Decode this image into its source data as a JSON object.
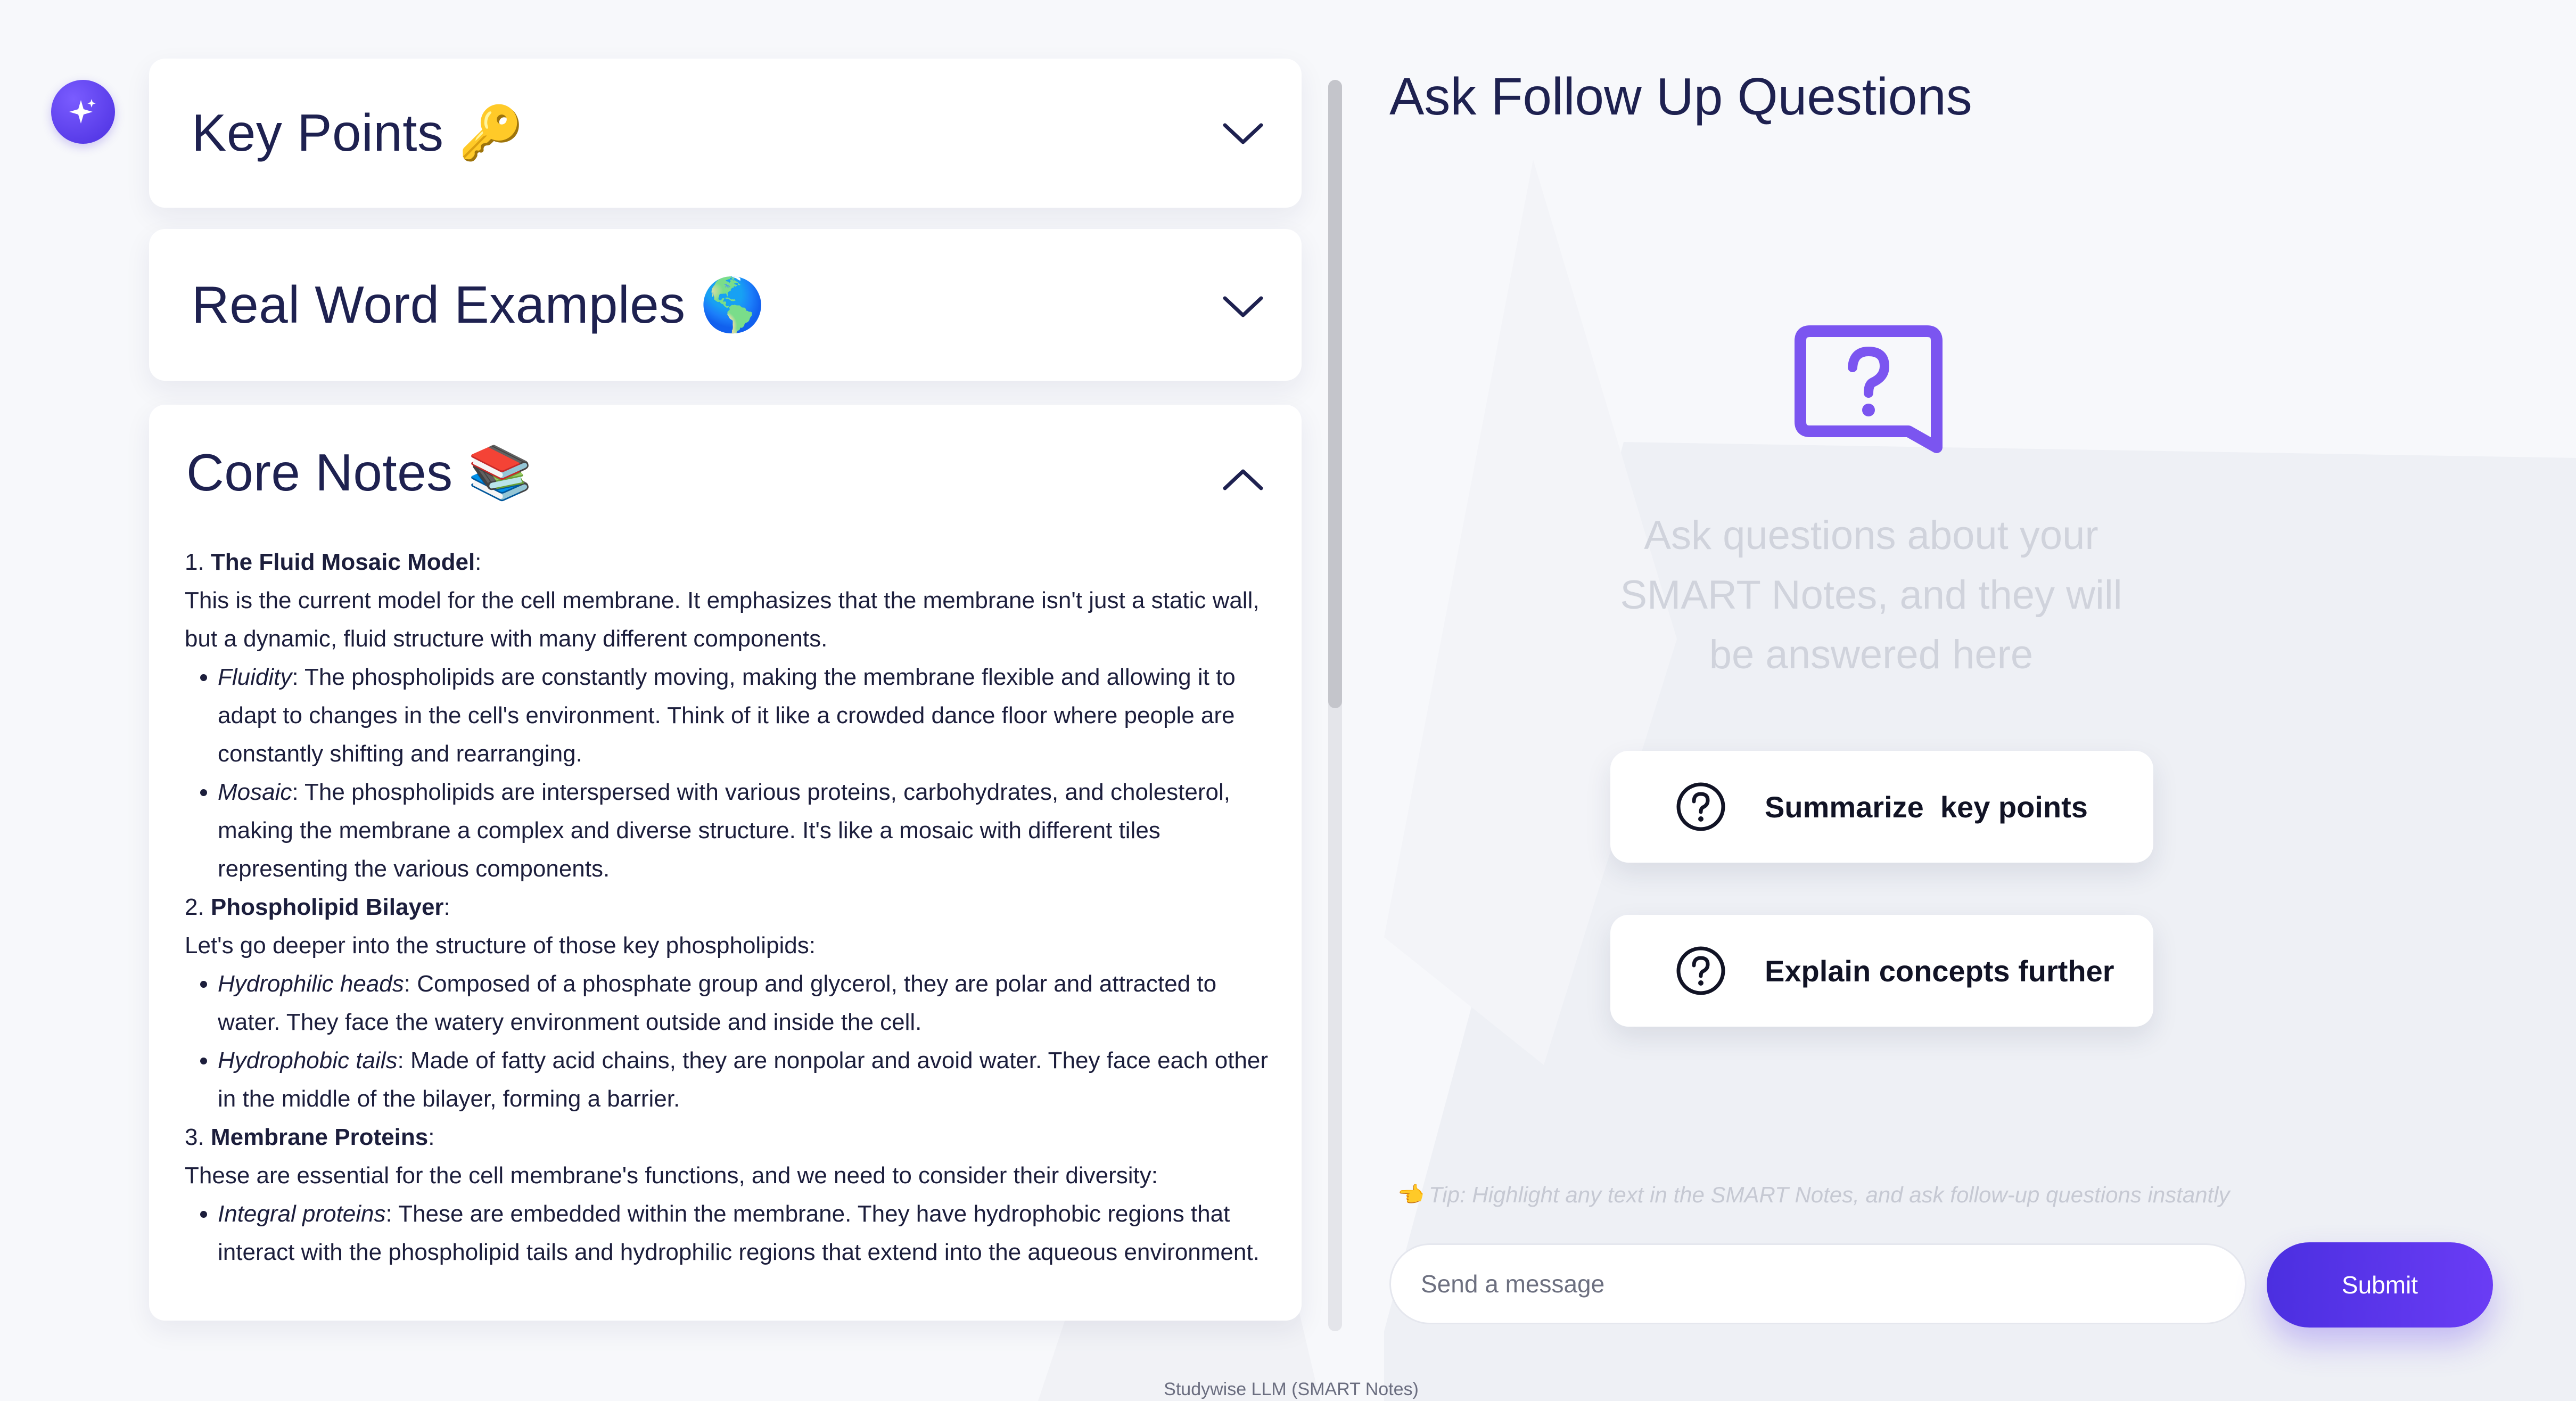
{
  "colors": {
    "accent": "#5b3cf0",
    "title_text": "#1e2150",
    "hint_text": "#d0d3dc"
  },
  "logo": {
    "icon": "sparkle-icon"
  },
  "cards": {
    "key_points": {
      "title": "Key Points 🔑",
      "chevron": "chevron-down-icon"
    },
    "real_world": {
      "title": "Real Word Examples 🌎",
      "chevron": "chevron-down-icon"
    },
    "core_notes": {
      "title": "Core Notes 📚",
      "chevron": "chevron-up-icon"
    }
  },
  "notes": {
    "s1": {
      "num": "1. ",
      "heading": "The Fluid Mosaic Model",
      "intro": "This is the current model for the cell membrane. It emphasizes that the membrane isn't just a static wall, but a dynamic, fluid structure with many different components.",
      "items": [
        {
          "term": "Fluidity",
          "text": ": The phospholipids are constantly moving, making the membrane flexible and allowing it to adapt to changes in the cell's environment. Think of it like a crowded dance floor where people are constantly shifting and rearranging."
        },
        {
          "term": "Mosaic",
          "text": ": The phospholipids are interspersed with various proteins, carbohydrates, and cholesterol, making the membrane a complex and diverse structure. It's like a mosaic with different tiles representing the various components."
        }
      ]
    },
    "s2": {
      "num": "2. ",
      "heading": "Phospholipid Bilayer",
      "intro": "Let's go deeper into the structure of those key phospholipids:",
      "items": [
        {
          "term": "Hydrophilic heads",
          "text": ": Composed of a phosphate group and glycerol, they are polar and attracted to water. They face the watery environment outside and inside the cell."
        },
        {
          "term": "Hydrophobic tails",
          "text": ": Made of fatty acid chains, they are nonpolar and avoid water. They face each other in the middle of the bilayer, forming a barrier."
        }
      ]
    },
    "s3": {
      "num": "3. ",
      "heading": "Membrane Proteins",
      "intro": "These are essential for the cell membrane's functions, and we need to consider their diversity:",
      "items": [
        {
          "term": "Integral proteins",
          "text": ": These are embedded within the membrane. They have hydrophobic regions that interact with the phospholipid tails and hydrophilic regions that extend into the aqueous environment."
        }
      ]
    }
  },
  "followup": {
    "title": "Ask Follow Up Questions",
    "icon": "question-bubble-icon",
    "hint": "Ask questions about your SMART Notes, and they will be answered here",
    "suggestions": [
      {
        "label": "Summarize  key points",
        "icon": "question-circle-icon"
      },
      {
        "label": "Explain concepts further",
        "icon": "question-circle-icon"
      }
    ],
    "tip": "👈 Tip: Highlight any text in the SMART Notes, and ask follow-up questions instantly",
    "input_placeholder": "Send a message",
    "input_value": "",
    "submit_label": "Submit"
  },
  "footer": {
    "text": "Studywise LLM (SMART Notes)"
  }
}
